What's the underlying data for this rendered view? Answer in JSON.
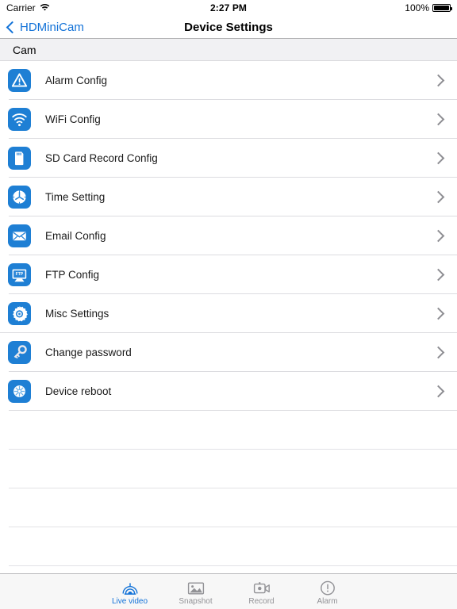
{
  "status_bar": {
    "carrier": "Carrier",
    "wifi_icon": "wifi-icon",
    "time": "2:27 PM",
    "battery_percent": "100%",
    "battery_icon": "battery-full-icon"
  },
  "nav_bar": {
    "back_icon": "chevron-left-icon",
    "back_label": "HDMiniCam",
    "title": "Device Settings"
  },
  "section": {
    "header": "Cam"
  },
  "rows": [
    {
      "label": "Alarm Config",
      "icon": "alarm-warning-icon",
      "chevron": "chevron-right-icon"
    },
    {
      "label": "WiFi Config",
      "icon": "wifi-signal-icon",
      "chevron": "chevron-right-icon"
    },
    {
      "label": "SD Card Record Config",
      "icon": "sd-card-icon",
      "chevron": "chevron-right-icon"
    },
    {
      "label": "Time Setting",
      "icon": "clock-icon",
      "chevron": "chevron-right-icon"
    },
    {
      "label": "Email Config",
      "icon": "envelope-icon",
      "chevron": "chevron-right-icon"
    },
    {
      "label": "FTP Config",
      "icon": "ftp-monitor-icon",
      "chevron": "chevron-right-icon"
    },
    {
      "label": "Misc Settings",
      "icon": "gear-icon",
      "chevron": "chevron-right-icon"
    },
    {
      "label": "Change password",
      "icon": "key-icon",
      "chevron": "chevron-right-icon"
    },
    {
      "label": "Device reboot",
      "icon": "reboot-burst-icon",
      "chevron": "chevron-right-icon"
    }
  ],
  "tab_bar": {
    "items": [
      {
        "label": "Live video",
        "icon": "dome-camera-icon",
        "active": true
      },
      {
        "label": "Snapshot",
        "icon": "photo-icon",
        "active": false
      },
      {
        "label": "Record",
        "icon": "video-camera-icon",
        "active": false
      },
      {
        "label": "Alarm",
        "icon": "exclamation-circle-icon",
        "active": false
      }
    ]
  },
  "colors": {
    "accent_blue": "#1272d8",
    "icon_blue": "#1e7fd4",
    "section_bg": "#f1f1f3",
    "separator": "#dcdce0",
    "tab_inactive": "#929296",
    "tab_bar_bg": "#f7f7f7"
  }
}
